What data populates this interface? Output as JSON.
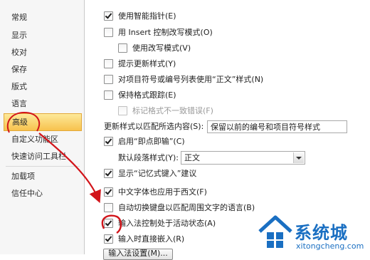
{
  "sidebar": {
    "items": [
      {
        "label": "常规"
      },
      {
        "label": "显示"
      },
      {
        "label": "校对"
      },
      {
        "label": "保存"
      },
      {
        "label": "版式"
      },
      {
        "label": "语言"
      },
      {
        "label": "高级"
      },
      {
        "label": "自定义功能区"
      },
      {
        "label": "快速访问工具栏"
      },
      {
        "label": "加载项"
      },
      {
        "label": "信任中心"
      }
    ],
    "active": "高级"
  },
  "options": [
    {
      "label": "使用智能指针(E)",
      "checked": true,
      "disabled": false
    },
    {
      "label": "用 Insert 控制改写模式(O)",
      "checked": false,
      "disabled": false
    },
    {
      "label": "使用改写模式(V)",
      "checked": false,
      "disabled": false
    },
    {
      "label": "提示更新样式(Y)",
      "checked": false,
      "disabled": false
    },
    {
      "label": "对项目符号或编号列表使用“正文”样式(N)",
      "checked": false,
      "disabled": false
    },
    {
      "label": "保持格式跟踪(E)",
      "checked": false,
      "disabled": false
    },
    {
      "label": "标记格式不一致错误(F)",
      "checked": false,
      "disabled": true
    },
    {
      "label": "启用“即点即输”(C)",
      "checked": true,
      "disabled": false
    },
    {
      "label": "显示“记忆式键入”建议",
      "checked": true,
      "disabled": false
    },
    {
      "label": "中文字体也应用于西文(F)",
      "checked": true,
      "disabled": false
    },
    {
      "label": "自动切换键盘以匹配周围文字的语言(B)",
      "checked": false,
      "disabled": false
    },
    {
      "label": "输入法控制处于活动状态(A)",
      "checked": true,
      "disabled": false
    },
    {
      "label": "输入时直接嵌入(R)",
      "checked": true,
      "disabled": false
    }
  ],
  "update_style": {
    "label": "更新样式以匹配所选内容(S):",
    "value": "保留以前的编号和项目符号样式"
  },
  "default_paragraph": {
    "label": "默认段落样式(Y):",
    "value": "正文"
  },
  "ime_settings_button": "输入法设置(M)...",
  "watermark": {
    "cn": "系统城",
    "en": "xitongcheng.com"
  },
  "colors": {
    "accent_red": "#d2141a",
    "active_nav": "#f7c24d",
    "watermark_blue": "#1a6fc2"
  },
  "annotation": {
    "arrow": "red-arrow",
    "circle": "red-circle"
  }
}
